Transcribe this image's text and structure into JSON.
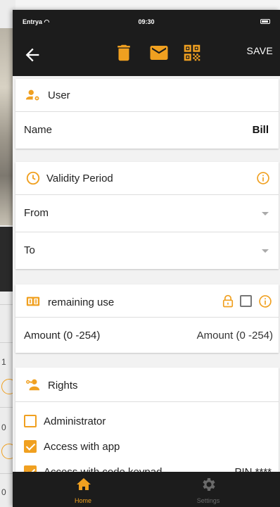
{
  "background": {
    "row_numbers": [
      "1",
      "0",
      "0"
    ]
  },
  "status_bar": {
    "carrier": "Entrya",
    "time": "09:30"
  },
  "app_bar": {
    "save_label": "SAVE",
    "icons": [
      "back-arrow-icon",
      "trash-icon",
      "mail-icon",
      "qr-code-icon"
    ]
  },
  "user": {
    "title": "User",
    "name_label": "Name",
    "name_value": "Bill"
  },
  "validity": {
    "title": "Validity Period",
    "from_label": "From",
    "to_label": "To"
  },
  "remaining": {
    "title": "remaining use",
    "amount_label": "Amount (0 -254)",
    "amount_placeholder": "Amount (0 -254)",
    "checked": false
  },
  "rights": {
    "title": "Rights",
    "items": [
      {
        "label": "Administrator",
        "checked": false
      },
      {
        "label": "Access with app",
        "checked": true
      },
      {
        "label": "Access with code keypad",
        "checked": true,
        "extra": "PIN ****"
      }
    ]
  },
  "bottom_nav": {
    "home_label": "Home",
    "settings_label": "Settings",
    "active": "home"
  },
  "colors": {
    "accent": "#f0a020",
    "bar": "#1c1c1c",
    "inactive": "#6a6a6a"
  }
}
